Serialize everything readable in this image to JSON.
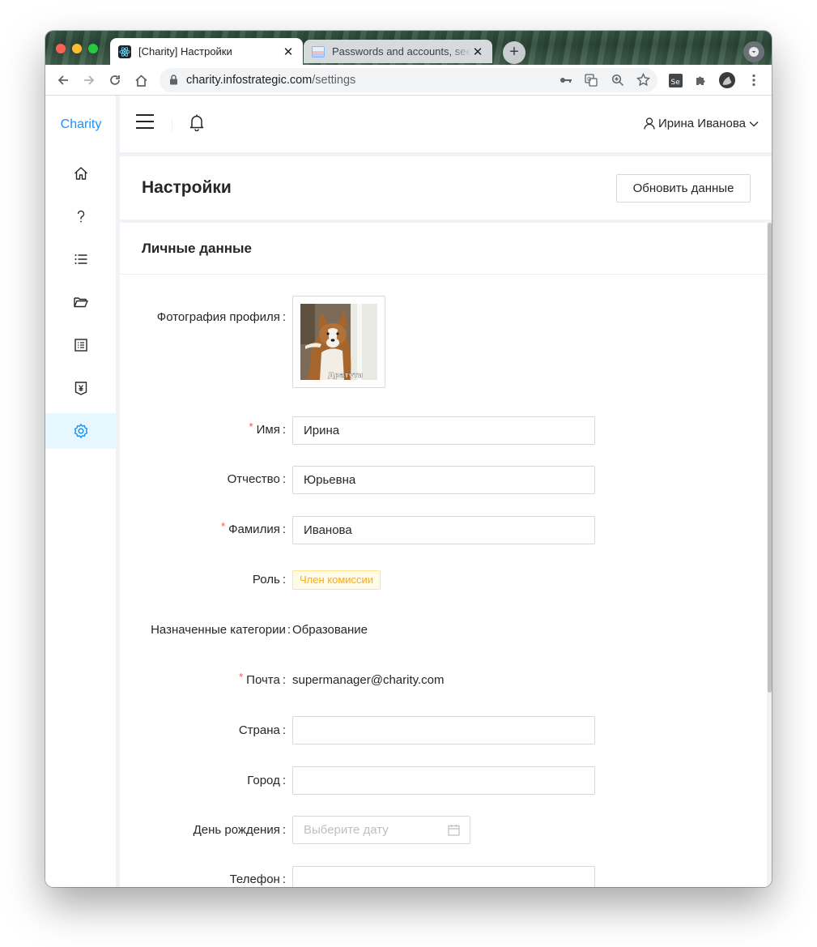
{
  "browser": {
    "tabs": [
      {
        "title": "[Charity] Настройки",
        "active": true
      },
      {
        "title": "Passwords and accounts, seed",
        "active": false
      }
    ],
    "url_host": "charity.infostrategic.com",
    "url_path": "/settings"
  },
  "app": {
    "brand": "Charity",
    "sidebar_items": [
      "home-icon",
      "question-icon",
      "list-icon",
      "folder-open-icon",
      "profile-icon",
      "money-collect-icon",
      "setting-icon"
    ],
    "active_sidebar_item": "setting-icon",
    "user_name": "Ирина Иванова"
  },
  "page": {
    "title": "Настройки",
    "refresh_button": "Обновить данные",
    "section_title": "Личные данные"
  },
  "form": {
    "photo_label": "Фотография профиля",
    "photo_caption": "Дратути",
    "first_name_label": "Имя",
    "first_name_value": "Ирина",
    "middle_name_label": "Отчество",
    "middle_name_value": "Юрьевна",
    "last_name_label": "Фамилия",
    "last_name_value": "Иванова",
    "role_label": "Роль",
    "role_value": "Член комиссии",
    "categories_label": "Назначенные категории",
    "categories_value": "Образование",
    "email_label": "Почта",
    "email_value": "supermanager@charity.com",
    "country_label": "Страна",
    "country_value": "",
    "city_label": "Город",
    "city_value": "",
    "birthday_label": "День рождения",
    "birthday_placeholder": "Выберите дату",
    "phone_label": "Телефон",
    "phone_value": ""
  },
  "colors": {
    "brand": "#1890ff",
    "required": "#ff4d4f",
    "tag_text": "#faad14",
    "tag_bg": "#fffbe6",
    "active_menu_bg": "#e6f7ff"
  }
}
